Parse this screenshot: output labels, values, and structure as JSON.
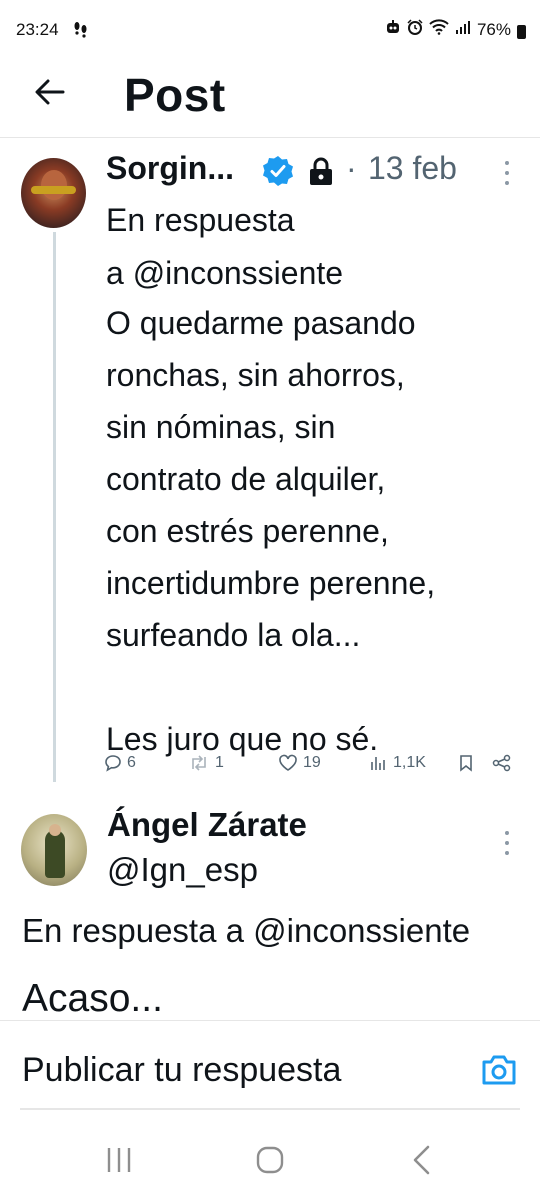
{
  "status_bar": {
    "time": "23:24",
    "battery": "76%"
  },
  "header": {
    "title": "Post"
  },
  "tweet1": {
    "author": "Sorgin...",
    "separator": "·",
    "date": "13 feb",
    "reply_to_prefix": "En respuesta",
    "reply_to_handle": "a @inconssiente",
    "body": "O quedarme pasando\nronchas, sin ahorros,\nsin nóminas, sin\ncontrato de alquiler,\ncon estrés perenne,\nincertidumbre perenne,\nsurfeando la ola...\n\nLes juro que no sé.",
    "replies": "6",
    "reposts": "1",
    "likes": "19",
    "views": "1,1K"
  },
  "tweet2": {
    "author": "Ángel Zárate",
    "handle": "@Ign_esp",
    "reply_to": "En respuesta a @inconssiente",
    "body": "Acaso..."
  },
  "reply_bar": {
    "placeholder": "Publicar tu respuesta"
  },
  "colors": {
    "accent": "#1d9bf0",
    "text": "#0f1419",
    "secondary": "#536471",
    "thread_line": "#cfd9de"
  }
}
